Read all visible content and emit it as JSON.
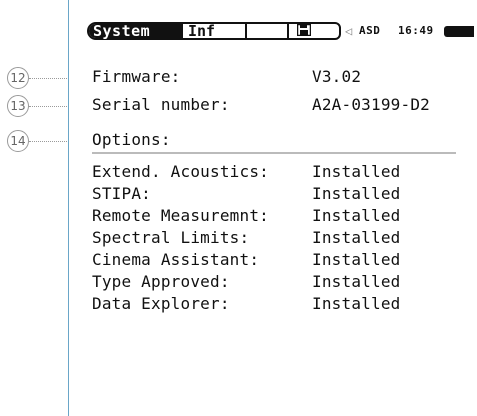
{
  "callouts": [
    "12",
    "13",
    "14"
  ],
  "statusbar": {
    "tab_system": "System",
    "tab_info": "Inf",
    "tab_save_icon": "floppy-disk",
    "meter_label": "ASD",
    "time": "16:49",
    "speaker_icon": "speaker",
    "battery_icon": "battery"
  },
  "info": {
    "firmware_label": "Firmware:",
    "firmware_value": "V3.02",
    "serial_label": "Serial number:",
    "serial_value": "A2A-03199-D2",
    "options_label": "Options:"
  },
  "options": [
    {
      "name": "Extend. Acoustics:",
      "status": "Installed"
    },
    {
      "name": "STIPA:",
      "status": "Installed"
    },
    {
      "name": "Remote Measuremnt:",
      "status": "Installed"
    },
    {
      "name": "Spectral Limits:",
      "status": "Installed"
    },
    {
      "name": "Cinema Assistant:",
      "status": "Installed"
    },
    {
      "name": "Type Approved:",
      "status": "Installed"
    },
    {
      "name": "Data Explorer:",
      "status": "Installed"
    }
  ]
}
